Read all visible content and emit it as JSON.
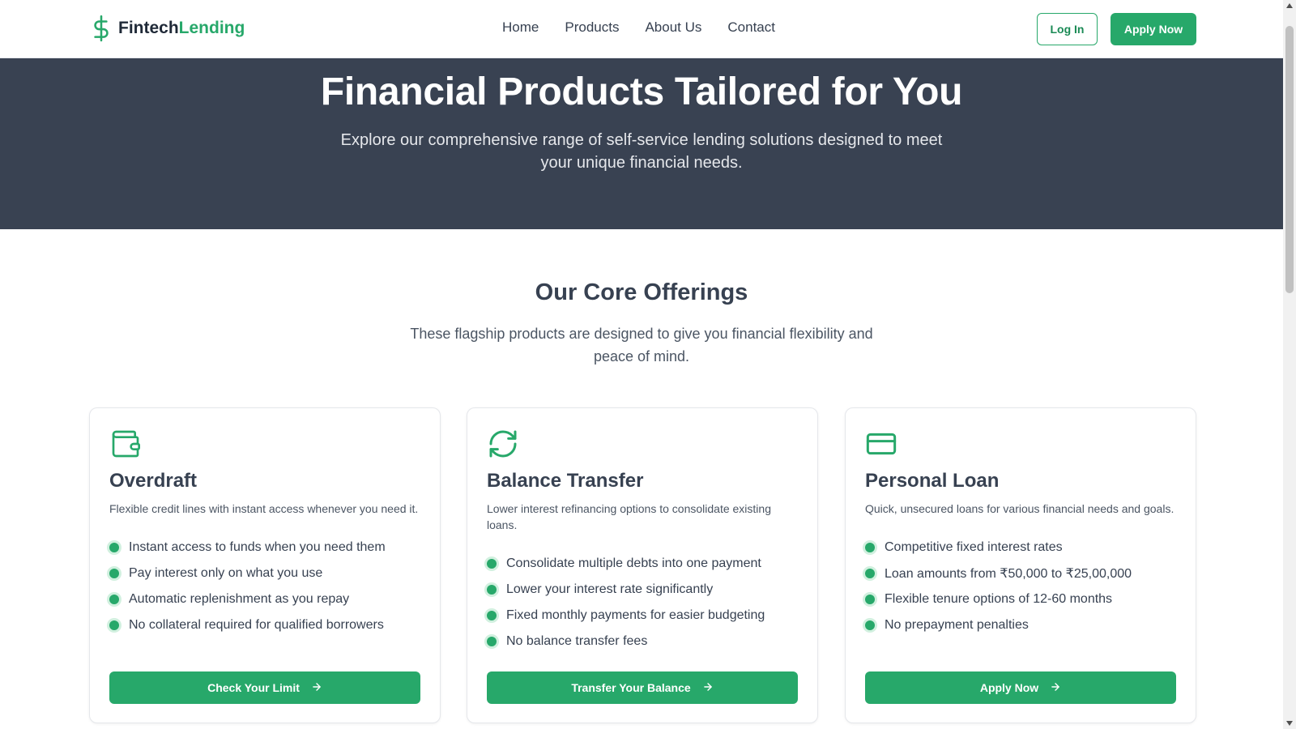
{
  "brand": {
    "name_part1": "Fintech",
    "name_part2": "Lending",
    "icon": "dollar-icon",
    "accent_color": "#27a86a"
  },
  "nav": {
    "items": [
      "Home",
      "Products",
      "About Us",
      "Contact"
    ]
  },
  "header_actions": {
    "login_label": "Log In",
    "apply_label": "Apply Now"
  },
  "hero": {
    "title": "Financial Products Tailored for You",
    "subtitle": "Explore our comprehensive range of self-service lending solutions designed to meet your unique financial needs.",
    "background_color": "#394252"
  },
  "offerings": {
    "title": "Our Core Offerings",
    "subtitle": "These flagship products are designed to give you financial flexibility and peace of mind.",
    "cards": [
      {
        "icon": "wallet-icon",
        "title": "Overdraft",
        "description": "Flexible credit lines with instant access whenever you need it.",
        "features": [
          "Instant access to funds when you need them",
          "Pay interest only on what you use",
          "Automatic replenishment as you repay",
          "No collateral required for qualified borrowers"
        ],
        "button_label": "Check Your Limit"
      },
      {
        "icon": "refresh-icon",
        "title": "Balance Transfer",
        "description": "Lower interest refinancing options to consolidate existing loans.",
        "features": [
          "Consolidate multiple debts into one payment",
          "Lower your interest rate significantly",
          "Fixed monthly payments for easier budgeting",
          "No balance transfer fees"
        ],
        "button_label": "Transfer Your Balance"
      },
      {
        "icon": "credit-card-icon",
        "title": "Personal Loan",
        "description": "Quick, unsecured loans for various financial needs and goals.",
        "features": [
          "Competitive fixed interest rates",
          "Loan amounts from ₹50,000 to ₹25,00,000",
          "Flexible tenure options of 12-60 months",
          "No prepayment penalties"
        ],
        "button_label": "Apply Now"
      }
    ]
  }
}
